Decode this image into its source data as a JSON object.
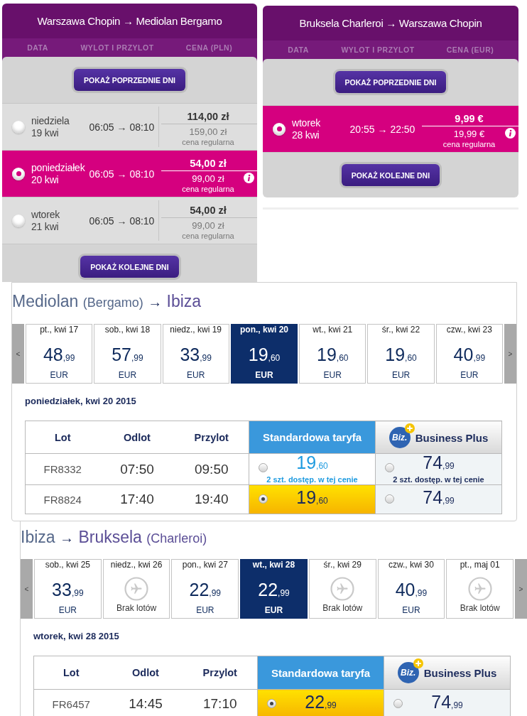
{
  "wizz_panels": [
    {
      "title": "Warszawa Chopin → Mediolan Bergamo",
      "columns": [
        "DATA",
        "WYLOT I PRZYLOT",
        "CENA (PLN)"
      ],
      "prev_button": "POKAŻ POPRZEDNIE DNI",
      "flights": [
        {
          "weekday": "niedziela",
          "date": "19 kwi",
          "times": "06:05 → 08:10",
          "price": "114,00 zł",
          "regular_price": "159,00 zł",
          "regular_label": "cena regularna",
          "selected": false
        },
        {
          "weekday": "poniedziałek",
          "date": "20 kwi",
          "times": "06:05 → 08:10",
          "price": "54,00 zł",
          "regular_price": "99,00 zł",
          "regular_label": "cena regularna",
          "selected": true
        },
        {
          "weekday": "wtorek",
          "date": "21 kwi",
          "times": "06:05 → 08:10",
          "price": "54,00 zł",
          "regular_price": "99,00 zł",
          "regular_label": "cena regularna",
          "selected": false
        }
      ],
      "next_button": "POKAŻ KOLEJNE DNI"
    },
    {
      "title": "Bruksela Charleroi → Warszawa Chopin",
      "columns": [
        "DATA",
        "WYLOT I PRZYLOT",
        "CENA (EUR)"
      ],
      "prev_button": "POKAŻ POPRZEDNIE DNI",
      "flights": [
        {
          "weekday": "wtorek",
          "date": "28 kwi",
          "times": "20:55 → 22:50",
          "price": "9,99 €",
          "regular_price": "19,99 €",
          "regular_label": "cena regularna",
          "selected": true
        }
      ],
      "next_button": "POKAŻ KOLEJNE DNI"
    }
  ],
  "ryanair_sections": [
    {
      "origin": "Mediolan",
      "origin_airport": "(Bergamo)",
      "arrow": "→",
      "destination": "Ibiza",
      "prev_arrow": "<",
      "next_arrow": ">",
      "days": [
        {
          "kind": "fare",
          "label": "pt., kwi 17",
          "price": "48",
          "cents": ",99",
          "currency": "EUR",
          "selected": false
        },
        {
          "kind": "fare",
          "label": "sob., kwi 18",
          "price": "57",
          "cents": ",99",
          "currency": "EUR",
          "selected": false
        },
        {
          "kind": "fare",
          "label": "niedz., kwi 19",
          "price": "33",
          "cents": ",99",
          "currency": "EUR",
          "selected": false
        },
        {
          "kind": "fare",
          "label": "pon., kwi 20",
          "price": "19",
          "cents": ",60",
          "currency": "EUR",
          "selected": true
        },
        {
          "kind": "fare",
          "label": "wt., kwi 21",
          "price": "19",
          "cents": ",60",
          "currency": "EUR",
          "selected": false
        },
        {
          "kind": "fare",
          "label": "śr., kwi 22",
          "price": "19",
          "cents": ",60",
          "currency": "EUR",
          "selected": false
        },
        {
          "kind": "fare",
          "label": "czw., kwi 23",
          "price": "40",
          "cents": ",99",
          "currency": "EUR",
          "selected": false
        }
      ],
      "day_title": "poniedziałek, kwi 20 2015",
      "columns": [
        "Lot",
        "Odlot",
        "Przylot"
      ],
      "fares": [
        {
          "kind": "standard",
          "label": "Standardowa taryfa"
        },
        {
          "kind": "business",
          "logo": "Biz.",
          "label": "Business Plus"
        }
      ],
      "rows": [
        {
          "flight": "FR8332",
          "departure": "07:50",
          "arrival": "09:50",
          "fares": [
            {
              "price": "19",
              "cents": ",60",
              "note": "2 szt. dostęp. w tej cenie",
              "selected": false
            },
            {
              "price": "74",
              "cents": ",99",
              "note": "2 szt. dostęp. w tej cenie",
              "selected": false
            }
          ]
        },
        {
          "flight": "FR8824",
          "departure": "17:40",
          "arrival": "19:40",
          "fares": [
            {
              "price": "19",
              "cents": ",60",
              "selected": true
            },
            {
              "price": "74",
              "cents": ",99",
              "selected": false
            }
          ]
        }
      ]
    },
    {
      "origin": "Ibiza",
      "arrow": "→",
      "destination": "Bruksela",
      "destination_airport": "(Charleroi)",
      "prev_arrow": "<",
      "next_arrow": ">",
      "days": [
        {
          "kind": "fare",
          "label": "sob., kwi 25",
          "price": "33",
          "cents": ",99",
          "currency": "EUR",
          "selected": false
        },
        {
          "kind": "none",
          "label": "niedz., kwi 26",
          "note": "Brak lotów",
          "selected": false
        },
        {
          "kind": "fare",
          "label": "pon., kwi 27",
          "price": "22",
          "cents": ",99",
          "currency": "EUR",
          "selected": false
        },
        {
          "kind": "fare",
          "label": "wt., kwi 28",
          "price": "22",
          "cents": ",99",
          "currency": "EUR",
          "selected": true
        },
        {
          "kind": "none",
          "label": "śr., kwi 29",
          "note": "Brak lotów",
          "selected": false
        },
        {
          "kind": "fare",
          "label": "czw., kwi 30",
          "price": "40",
          "cents": ",99",
          "currency": "EUR",
          "selected": false
        },
        {
          "kind": "none",
          "label": "pt., maj 01",
          "note": "Brak lotów",
          "selected": false
        }
      ],
      "day_title": "wtorek, kwi 28 2015",
      "columns": [
        "Lot",
        "Odlot",
        "Przylot"
      ],
      "fares": [
        {
          "kind": "standard",
          "label": "Standardowa taryfa"
        },
        {
          "kind": "business",
          "logo": "Biz.",
          "label": "Business Plus"
        }
      ],
      "rows": [
        {
          "flight": "FR6457",
          "departure": "14:45",
          "arrival": "17:10",
          "fares": [
            {
              "price": "22",
              "cents": ",99",
              "selected": true
            },
            {
              "price": "74",
              "cents": ",99",
              "selected": false
            }
          ]
        }
      ]
    }
  ]
}
